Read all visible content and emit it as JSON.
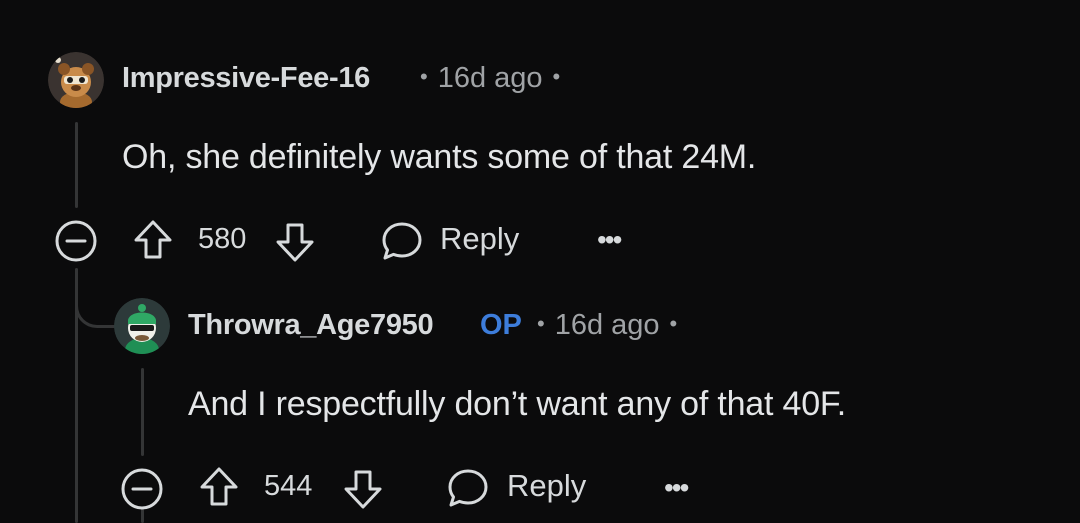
{
  "comments": [
    {
      "username": "Impressive-Fee-16",
      "timestamp": "16d ago",
      "body": "Oh, she definitely wants some of that 24M.",
      "score": "580",
      "reply_label": "Reply",
      "more_label": "•••",
      "avatar_icon": "snoo-avatar-bear-hat"
    },
    {
      "username": "Throwra_Age7950",
      "badge": "OP",
      "timestamp": "16d ago",
      "body": "And I respectfully don’t want any of that 40F.",
      "score": "544",
      "reply_label": "Reply",
      "more_label": "•••",
      "avatar_icon": "snoo-avatar-green"
    }
  ],
  "colors": {
    "background": "#0b0b0c",
    "op_badge": "#3d7ddb",
    "text": "#e4e6e8",
    "muted": "#a0a3a6"
  }
}
